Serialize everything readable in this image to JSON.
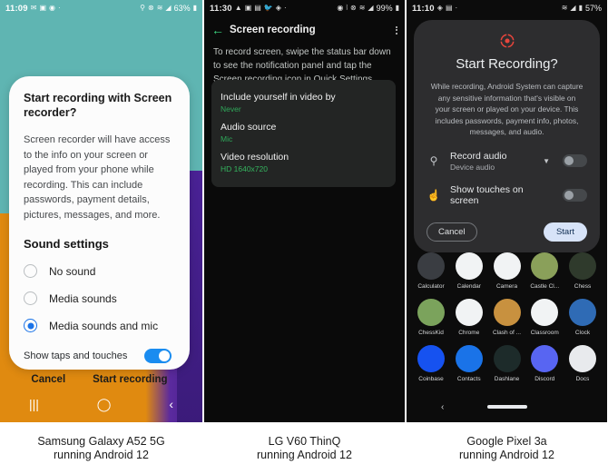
{
  "panels": [
    {
      "id": "samsung",
      "caption_line1": "Samsung Galaxy A52 5G",
      "caption_line2": "running Android 12",
      "status": {
        "time": "11:09",
        "battery": "63%",
        "left_icons": [
          "message-icon",
          "gallery-icon",
          "alarm-icon",
          "dot-icon"
        ],
        "right_icons": [
          "microphone-icon",
          "mute-icon",
          "wifi-icon",
          "signal-icon",
          "battery-icon"
        ]
      },
      "dialog": {
        "title": "Start recording with Screen recorder?",
        "body": "Screen recorder will have access to the info on your screen or played from your phone while recording. This can include passwords, payment details, pictures, messages, and more.",
        "section_title": "Sound settings",
        "options": [
          {
            "label": "No sound",
            "selected": false
          },
          {
            "label": "Media sounds",
            "selected": false
          },
          {
            "label": "Media sounds and mic",
            "selected": true
          }
        ],
        "toggle_label": "Show taps and touches",
        "toggle_on": true,
        "cancel_label": "Cancel",
        "confirm_label": "Start recording"
      },
      "navbar": [
        "recents-icon",
        "home-icon",
        "back-icon"
      ]
    },
    {
      "id": "lg",
      "caption_line1": "LG V60 ThinQ",
      "caption_line2": "running Android 12",
      "status": {
        "time": "11:30",
        "battery": "99%",
        "left_icons": [
          "warning-icon",
          "calculator-icon",
          "download-icon",
          "twitter-icon",
          "vpn-icon",
          "dot-icon"
        ],
        "right_icons": [
          "alarm-icon",
          "bluetooth-icon",
          "mute-icon",
          "wifi-icon",
          "signal-icon",
          "battery-icon"
        ]
      },
      "header": {
        "back_icon": "back-arrow-icon",
        "title": "Screen recording",
        "menu_icon": "overflow-menu-icon"
      },
      "description": "To record screen, swipe the status bar down to see the notification panel and tap the Screen recording icon in Quick Settings.",
      "settings": [
        {
          "title": "Include yourself in video by",
          "value": "Never"
        },
        {
          "title": "Audio source",
          "value": "Mic"
        },
        {
          "title": "Video resolution",
          "value": "HD 1640x720"
        }
      ]
    },
    {
      "id": "pixel",
      "caption_line1": "Google Pixel 3a",
      "caption_line2": "running Android 12",
      "status": {
        "time": "11:10",
        "battery": "57%",
        "left_icons": [
          "vpn-icon",
          "calculator-icon",
          "dot-icon"
        ],
        "right_icons": [
          "wifi-icon",
          "signal-icon",
          "battery-icon"
        ]
      },
      "dialog": {
        "record_icon": "record-target-icon",
        "title": "Start Recording?",
        "body": "While recording, Android System can capture any sensitive information that's visible on your screen or played on your device. This includes passwords, payment info, photos, messages, and audio.",
        "rows": [
          {
            "icon": "microphone-icon",
            "title": "Record audio",
            "subtitle": "Device audio",
            "has_caret": true,
            "toggle_on": false
          },
          {
            "icon": "touch-icon",
            "title": "Show touches on screen",
            "subtitle": "",
            "has_caret": false,
            "toggle_on": false
          }
        ],
        "cancel_label": "Cancel",
        "start_label": "Start"
      },
      "apps": [
        [
          {
            "name": "Calculator",
            "color": "#3a3d42"
          },
          {
            "name": "Calendar",
            "color": "#f1f3f4"
          },
          {
            "name": "Camera",
            "color": "#f1f3f4"
          },
          {
            "name": "Castle Cl...",
            "color": "#8aa05a"
          },
          {
            "name": "Chess",
            "color": "#2f3a2c"
          }
        ],
        [
          {
            "name": "ChessKid",
            "color": "#7ba35c"
          },
          {
            "name": "Chrome",
            "color": "#f1f3f4"
          },
          {
            "name": "Clash of ...",
            "color": "#c8913f"
          },
          {
            "name": "Classroom",
            "color": "#f1f3f4"
          },
          {
            "name": "Clock",
            "color": "#2f6bb5"
          }
        ],
        [
          {
            "name": "Coinbase",
            "color": "#1652f0"
          },
          {
            "name": "Contacts",
            "color": "#1a73e8"
          },
          {
            "name": "Dashlane",
            "color": "#1d2b2a"
          },
          {
            "name": "Discord",
            "color": "#5865f2"
          },
          {
            "name": "Docs",
            "color": "#e8eaed"
          }
        ]
      ],
      "navbar": {
        "back_icon": "back-icon",
        "home_pill": "home-gesture-pill"
      }
    }
  ],
  "colors": {
    "teal": "#5fb5b2",
    "orange": "#e08a10",
    "purple": "#4a2296",
    "accent_blue": "#1a73e8",
    "lg_green": "#3ddc84",
    "record_red": "#e8453c"
  }
}
